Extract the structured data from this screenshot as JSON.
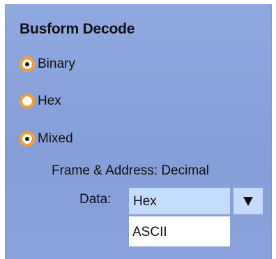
{
  "panel": {
    "title": "Busform Decode",
    "options": [
      {
        "label": "Binary",
        "selected": true
      },
      {
        "label": "Hex",
        "selected": false
      },
      {
        "label": "Mixed",
        "selected": true
      }
    ],
    "frame_address_text": "Frame & Address: Decimal",
    "data_label": "Data:",
    "data_select": {
      "value": "Hex",
      "options": [
        "ASCII"
      ]
    }
  },
  "colors": {
    "panel_bg": "#8ca5de",
    "radio_ring": "#f6a12a",
    "select_bg": "#c6dcff"
  },
  "icons": {
    "dropdown": "chevron-down-icon"
  }
}
